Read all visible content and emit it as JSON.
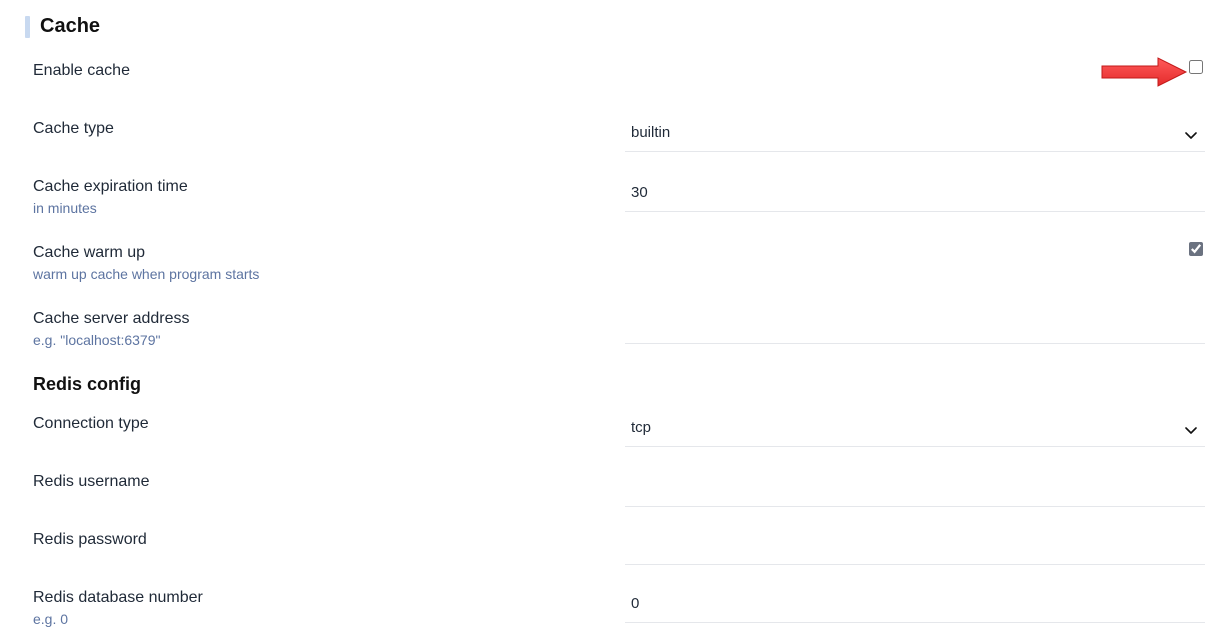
{
  "section_title": "Cache",
  "redis_title": "Redis config",
  "rows": {
    "enable_cache": {
      "label": "Enable cache",
      "checked": false
    },
    "cache_type": {
      "label": "Cache type",
      "value": "builtin",
      "options": [
        "builtin"
      ]
    },
    "cache_exp": {
      "label": "Cache expiration time",
      "hint": "in minutes",
      "value": "30"
    },
    "cache_warm": {
      "label": "Cache warm up",
      "hint": "warm up cache when program starts",
      "checked": true
    },
    "cache_addr": {
      "label": "Cache server address",
      "hint": "e.g. \"localhost:6379\"",
      "value": ""
    },
    "conn_type": {
      "label": "Connection type",
      "value": "tcp",
      "options": [
        "tcp"
      ]
    },
    "redis_user": {
      "label": "Redis username",
      "value": ""
    },
    "redis_pass": {
      "label": "Redis password",
      "value": ""
    },
    "redis_db": {
      "label": "Redis database number",
      "hint": "e.g. 0",
      "value": "0"
    }
  }
}
